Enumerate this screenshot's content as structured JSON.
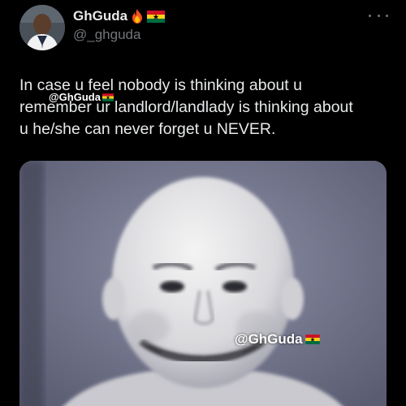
{
  "post": {
    "author": {
      "display_name": "GhGuda",
      "handle": "@_ghguda",
      "badges": [
        "fire-emoji",
        "ghana-flag-emoji"
      ]
    },
    "text_lines": [
      "In case u feel nobody is thinking about u",
      "remember ur landlord/landlady is thinking about",
      "u he/she can never forget u NEVER."
    ],
    "watermarks": {
      "text_overlay": "@GhGuda",
      "media_overlay": "@GhGuda"
    }
  },
  "colors": {
    "background": "#000000",
    "primary_text": "#e7e9ea",
    "secondary_text": "#71767b"
  }
}
